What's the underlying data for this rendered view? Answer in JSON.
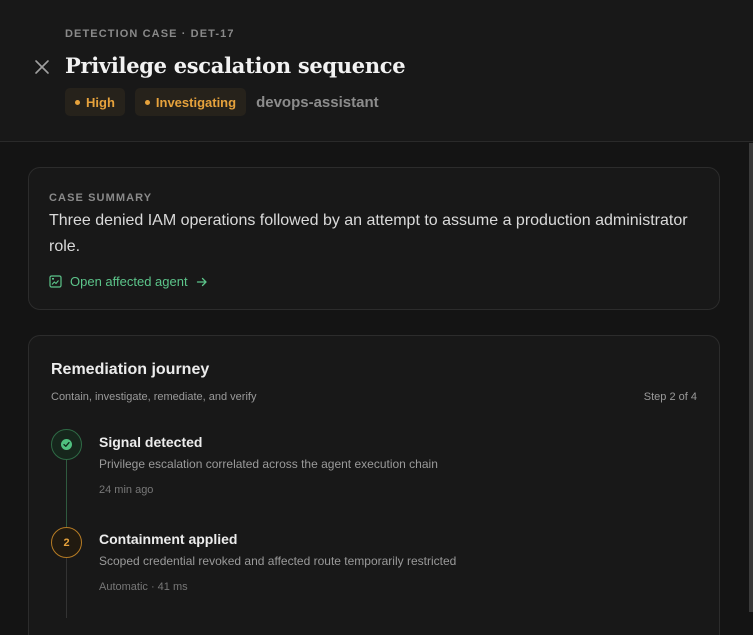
{
  "header": {
    "eyebrow": "DETECTION CASE · DET-17",
    "title": "Privilege escalation sequence",
    "severity": "High",
    "status": "Investigating",
    "agent": "devops-assistant"
  },
  "summary": {
    "label": "CASE SUMMARY",
    "text": "Three denied IAM operations followed by an attempt to assume a production administrator role.",
    "link": "Open affected agent"
  },
  "journey": {
    "title": "Remediation journey",
    "subtitle": "Contain, investigate, remediate, and verify",
    "step_indicator": "Step 2 of 4",
    "steps": [
      {
        "title": "Signal detected",
        "description": "Privilege escalation correlated across the agent execution chain",
        "meta": "24 min ago",
        "state": "done"
      },
      {
        "number": "2",
        "title": "Containment applied",
        "description": "Scoped credential revoked and affected route temporarily restricted",
        "meta": "Automatic · 41 ms",
        "state": "active"
      }
    ]
  },
  "colors": {
    "accent_amber": "#e6a23c",
    "accent_green": "#4fbf7f",
    "background": "#141414",
    "card": "#181818"
  },
  "icons": {
    "close": "close-icon",
    "agent_link": "agent-image-icon",
    "arrow": "arrow-right-icon",
    "check": "check-icon"
  }
}
